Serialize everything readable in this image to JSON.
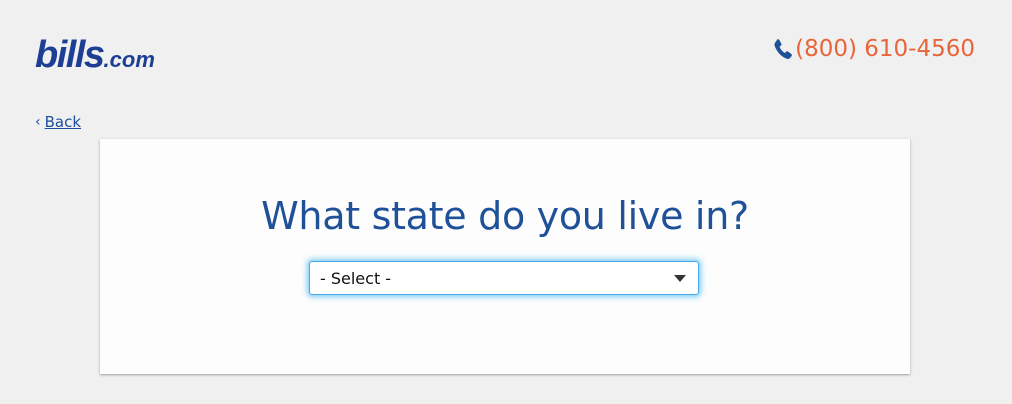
{
  "header": {
    "logo": {
      "main": "bills",
      "tld": ".com"
    },
    "phone": {
      "number": "(800) 610-4560",
      "icon": "phone-icon"
    }
  },
  "nav": {
    "back_label": "Back",
    "back_icon": "chevron-left-icon"
  },
  "card": {
    "question": "What state do you live in?",
    "state_select": {
      "selected": "- Select -",
      "icon": "caret-down-icon"
    }
  },
  "colors": {
    "brand_blue": "#1c3f94",
    "heading_blue": "#1f5199",
    "phone_orange": "#e8653a",
    "focus_glow": "#50bef5",
    "background": "#f0f0f0"
  }
}
